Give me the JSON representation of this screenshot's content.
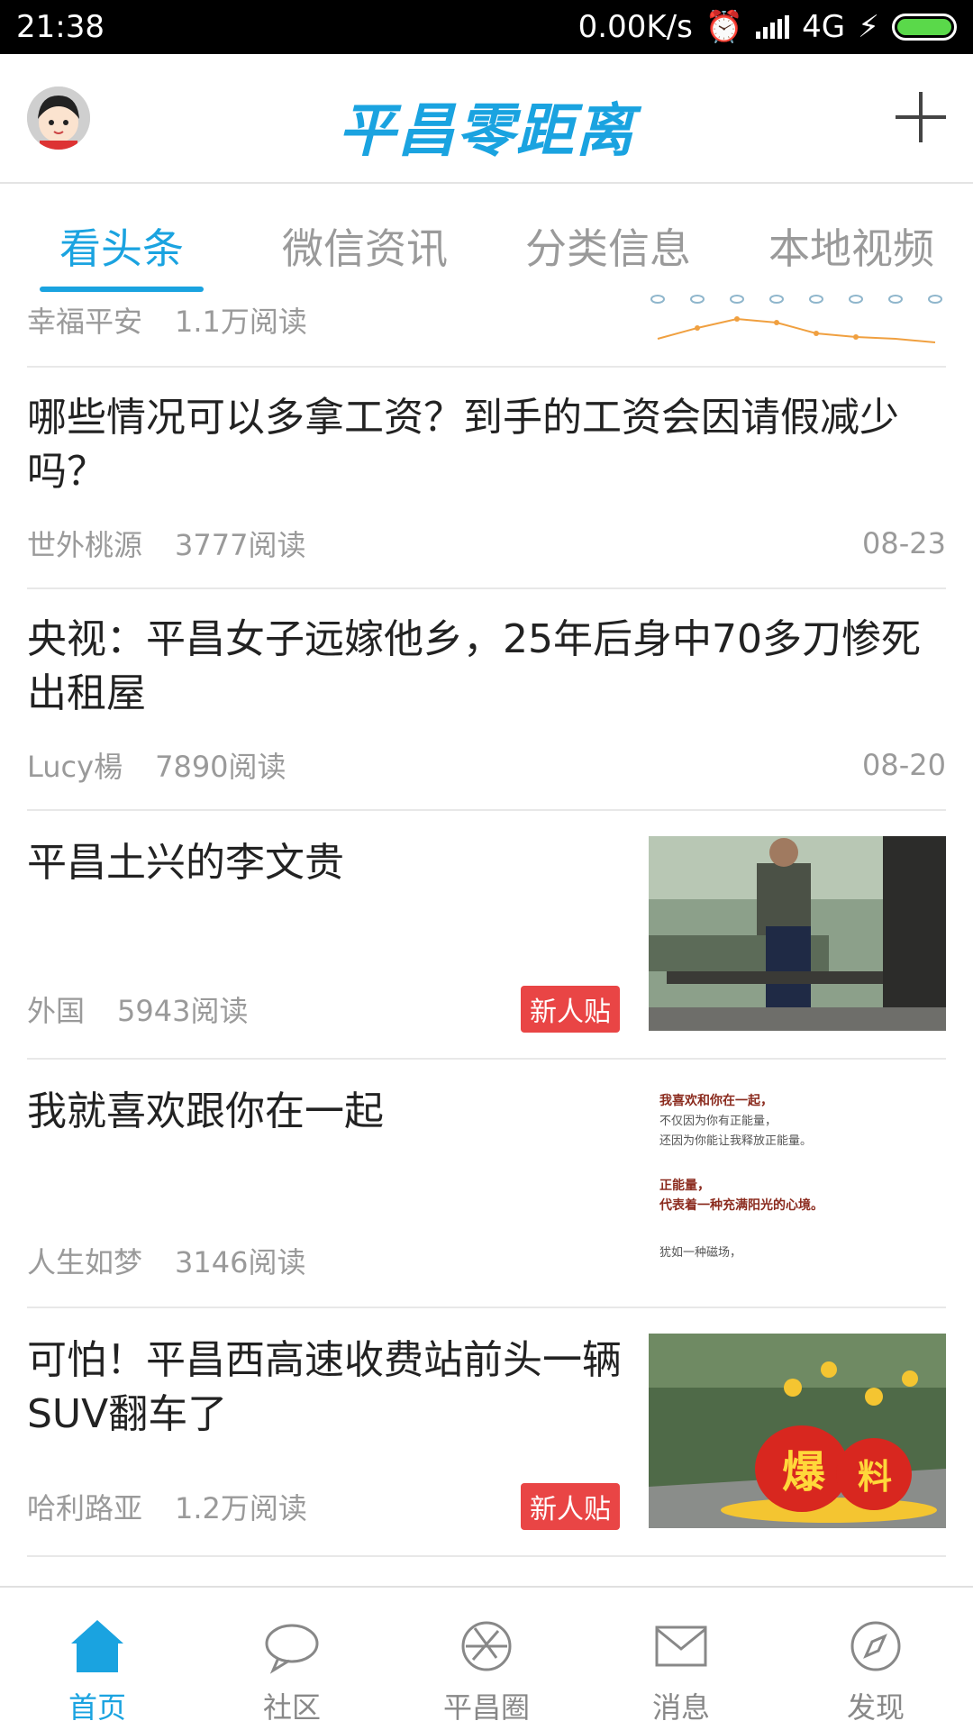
{
  "status": {
    "time": "21:38",
    "speed": "0.00K/s",
    "network": "4G"
  },
  "header": {
    "logo": "平昌零距离"
  },
  "tabs": [
    "看头条",
    "微信资讯",
    "分类信息",
    "本地视频"
  ],
  "feed": [
    {
      "author": "幸福平安",
      "reads": "1.1万阅读"
    },
    {
      "title": "哪些情况可以多拿工资？到手的工资会因请假减少吗？",
      "author": "世外桃源",
      "reads": "3777阅读",
      "date": "08-23"
    },
    {
      "title": "央视：平昌女子远嫁他乡，25年后身中70多刀惨死出租屋",
      "author": "Lucy楊",
      "reads": "7890阅读",
      "date": "08-20"
    },
    {
      "title": "平昌土兴的李文贵",
      "author": "外国",
      "reads": "5943阅读",
      "badge": "新人贴"
    },
    {
      "title": "我就喜欢跟你在一起",
      "author": "人生如梦",
      "reads": "3146阅读",
      "image_text": [
        "我喜欢和你在一起，",
        "不仅因为你有正能量，",
        "还因为你能让我释放正能量。",
        "正能量，",
        "代表着一种充满阳光的心境。",
        "犹如一种磁场，"
      ]
    },
    {
      "title": "可怕！平昌西高速收费站前头一辆SUV翻车了",
      "author": "哈利路亚",
      "reads": "1.2万阅读",
      "badge": "新人贴",
      "image_text": [
        "爆",
        "料"
      ]
    }
  ],
  "bottom_nav": [
    "首页",
    "社区",
    "平昌圈",
    "消息",
    "发现"
  ]
}
